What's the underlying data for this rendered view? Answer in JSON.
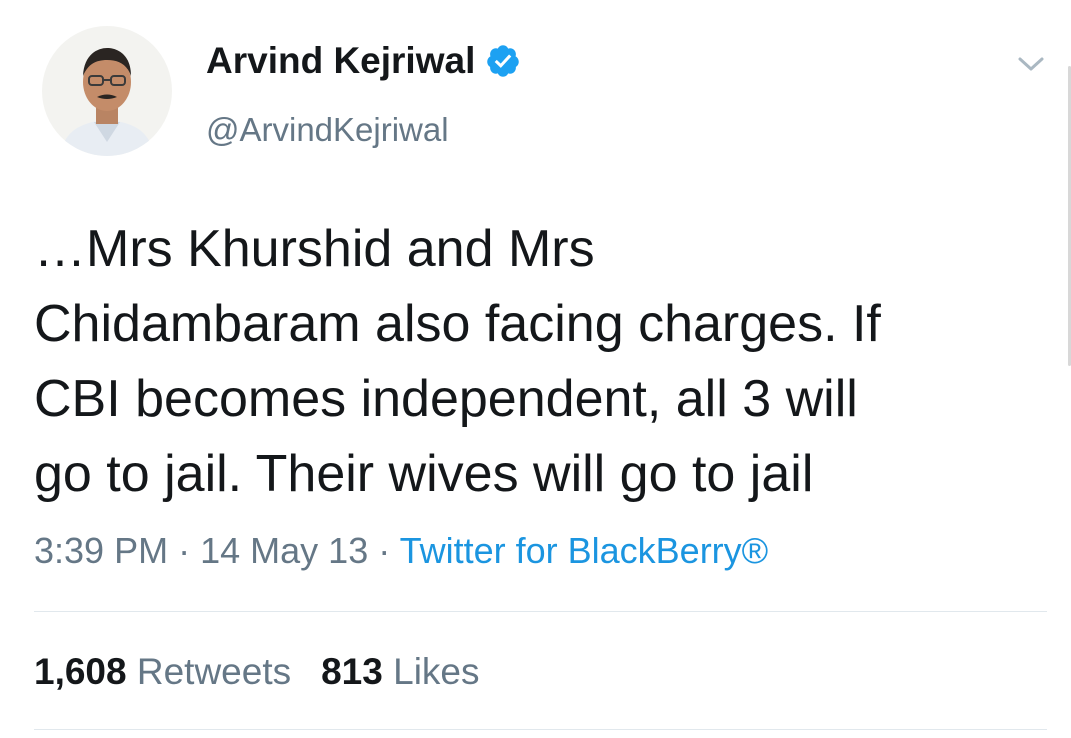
{
  "user": {
    "display_name": "Arvind Kejriwal",
    "handle": "@ArvindKejriwal",
    "verified": true
  },
  "tweet": {
    "lines": [
      "…Mrs Khurshid and Mrs",
      "Chidambaram also facing charges. If",
      "CBI becomes independent, all 3 will",
      "go to jail. Their wives will go to jail"
    ]
  },
  "meta": {
    "time": "3:39 PM",
    "separator": "·",
    "date": "14 May 13",
    "source": "Twitter for BlackBerry®"
  },
  "stats": {
    "retweets_count": "1,608",
    "retweets_label": "Retweets",
    "likes_count": "813",
    "likes_label": "Likes"
  },
  "colors": {
    "text": "#14171a",
    "secondary": "#657786",
    "link": "#1b95e0",
    "verified": "#1da1f2"
  },
  "icons": {
    "verified": "verified-badge-icon",
    "menu": "chevron-down-icon"
  }
}
